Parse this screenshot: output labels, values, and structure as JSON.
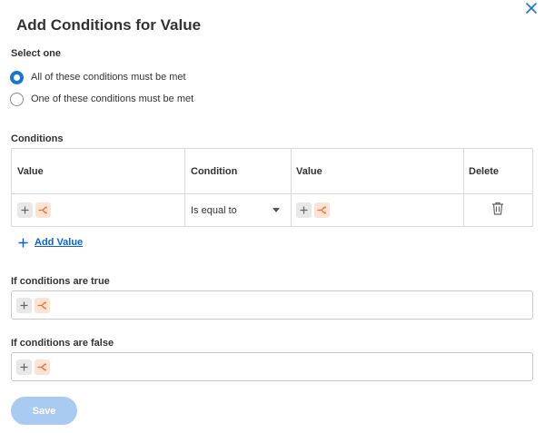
{
  "dialog": {
    "title": "Add Conditions for Value",
    "close_icon": "close-icon"
  },
  "select_one": {
    "label": "Select one",
    "options": [
      {
        "label": "All of these conditions must be met",
        "selected": true
      },
      {
        "label": "One of these conditions must be met",
        "selected": false
      }
    ]
  },
  "conditions": {
    "label": "Conditions",
    "columns": [
      "Value",
      "Condition",
      "Value",
      "Delete"
    ],
    "rows": [
      {
        "left_value_icons": [
          "plus-icon",
          "prompt-icon"
        ],
        "condition": "Is equal to",
        "right_value_icons": [
          "plus-icon",
          "prompt-icon"
        ],
        "delete_icon": "trash-icon"
      }
    ],
    "add_value_label": "Add Value"
  },
  "if_true": {
    "label": "If conditions are true"
  },
  "if_false": {
    "label": "If conditions are false"
  },
  "actions": {
    "save_label": "Save",
    "save_enabled": false
  },
  "colors": {
    "accent": "#1a73d9",
    "link": "#0b62d6",
    "save_disabled": "#a9cbf2",
    "prompt_chip": "#fde3d3",
    "prompt_glyph": "#e8733a"
  }
}
